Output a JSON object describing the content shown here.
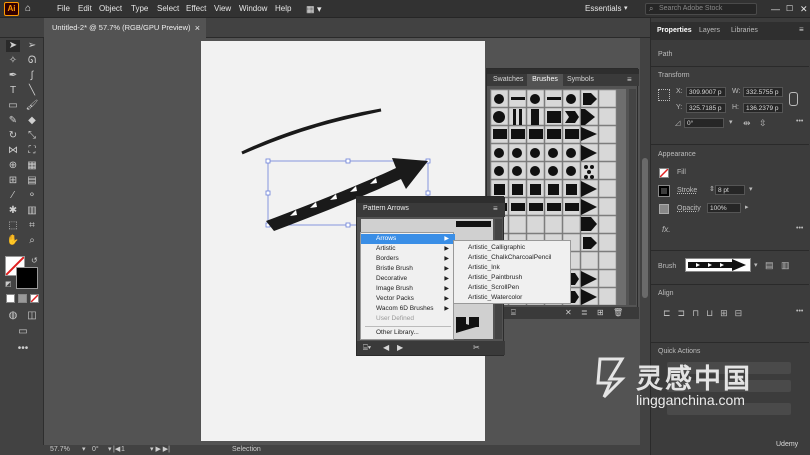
{
  "menubar": {
    "logo": "Ai",
    "items": [
      "File",
      "Edit",
      "Object",
      "Type",
      "Select",
      "Effect",
      "View",
      "Window",
      "Help"
    ],
    "workspace": "Essentials",
    "search_placeholder": "Search Adobe Stock"
  },
  "document_tab": {
    "title": "Untitled-2* @ 57.7% (RGB/GPU Preview)",
    "close": "×"
  },
  "status": {
    "zoom": "57.7%",
    "rotation": "0°",
    "artboard": "1",
    "mode": "Selection"
  },
  "brushes_panel": {
    "tabs": [
      "Swatches",
      "Brushes",
      "Symbols"
    ]
  },
  "pattern_panel": {
    "title": "Pattern Arrows"
  },
  "library_menu": {
    "items": [
      {
        "label": "Arrows",
        "selected": true,
        "sub": true
      },
      {
        "label": "Artistic",
        "sub": true
      },
      {
        "label": "Borders",
        "sub": true
      },
      {
        "label": "Bristle Brush",
        "sub": true
      },
      {
        "label": "Decorative",
        "sub": true
      },
      {
        "label": "Image Brush",
        "sub": true
      },
      {
        "label": "Vector Packs",
        "sub": true
      },
      {
        "label": "Wacom 6D Brushes",
        "sub": true
      },
      {
        "label": "User Defined",
        "disabled": true
      },
      {
        "label": "Other Library..."
      }
    ],
    "submenu": [
      "Artistic_Calligraphic",
      "Artistic_ChalkCharcoalPencil",
      "Artistic_Ink",
      "Artistic_Paintbrush",
      "Artistic_ScrollPen",
      "Artistic_Watercolor"
    ]
  },
  "properties": {
    "tabs": [
      "Properties",
      "Layers",
      "Libraries"
    ],
    "selection_type": "Path",
    "transform_title": "Transform",
    "x_label": "X:",
    "x": "309.9007 p",
    "y_label": "Y:",
    "y": "325.7185 p",
    "w_label": "W:",
    "w": "332.5755 p",
    "h_label": "H:",
    "h": "136.2379 p",
    "angle": "0°",
    "appearance_title": "Appearance",
    "fill_label": "Fill",
    "stroke_label": "Stroke",
    "stroke_value": "8 pt",
    "opacity_label": "Opacity",
    "opacity_value": "100%",
    "fx": "fx.",
    "brush_label": "Brush",
    "align_title": "Align",
    "quick_actions_title": "Quick Actions"
  },
  "watermark": {
    "cn": "灵感中国",
    "url": "lingganchina.com",
    "udemy": "Udemy"
  }
}
